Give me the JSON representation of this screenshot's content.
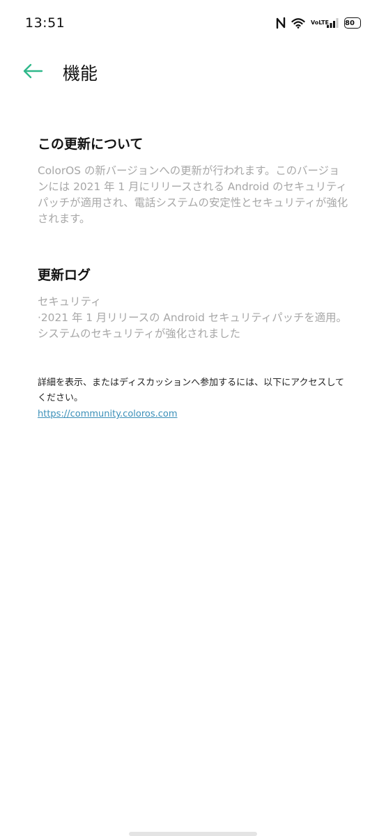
{
  "status_bar": {
    "time": "13:51",
    "volte_top": "Vo",
    "volte_bottom": "LTE",
    "battery_level": "80",
    "icons": [
      "nfc-icon",
      "wifi-icon",
      "volte-icon",
      "signal-icon",
      "battery-icon"
    ]
  },
  "app_bar": {
    "back_icon": "arrow-left-icon",
    "title": "機能",
    "accent_color": "#2fb88a"
  },
  "about": {
    "heading": "この更新について",
    "body": "ColorOS の新バージョンへの更新が行われます。このバージョンには 2021 年 1 月にリリースされる Android のセキュリティパッチが適用され、電話システムの安定性とセキュリティが強化されます。"
  },
  "changelog": {
    "heading": "更新ログ",
    "category": "セキュリティ",
    "item": "·2021 年 1 月リリースの Android セキュリティパッチを適用。システムのセキュリティが強化されました"
  },
  "more_info": {
    "text": "詳細を表示、またはディスカッションへ参加するには、以下にアクセスしてください。",
    "link": "https://community.coloros.com",
    "link_color": "#3a8fb8"
  }
}
